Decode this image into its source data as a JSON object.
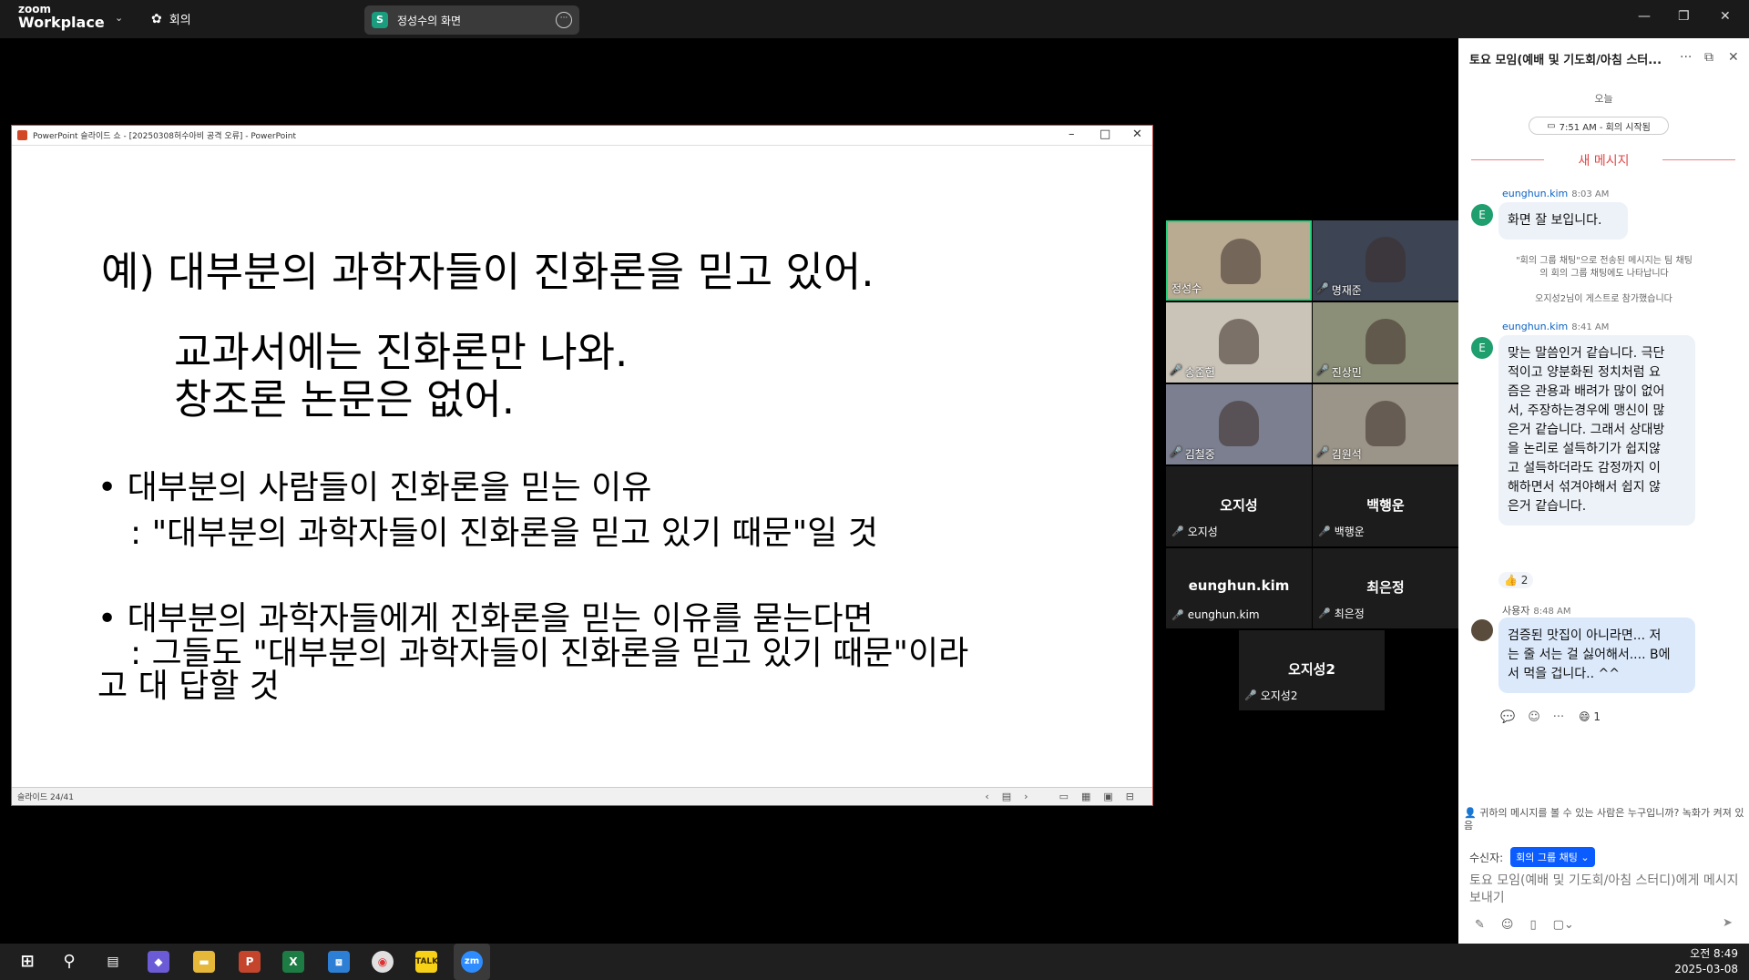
{
  "topbar": {
    "logo_line1": "zoom",
    "logo_line2": "Workplace",
    "meeting_label": "회의",
    "share_badge": "S",
    "share_name": "정성수의 화면"
  },
  "ppt": {
    "title": "PowerPoint 슬라이드 쇼 - [20250308허수아비 공격 오류] - PowerPoint",
    "status": "슬라이드 24/41",
    "slide": {
      "line1": "예) 대부분의 과학자들이 진화론을 믿고 있어.",
      "line2": "교과서에는 진화론만 나와.",
      "line3": "창조론 논문은 없어.",
      "bullet1": "• 대부분의 사람들이 진화론을 믿는 이유",
      "bullet1_sub": ": \"대부분의 과학자들이 진화론을 믿고 있기 때문\"일 것",
      "bullet2": "• 대부분의 과학자들에게 진화론을 믿는 이유를 묻는다면",
      "bullet2_sub": ": 그들도 \"대부분의 과학자들이 진화론을 믿고 있기 때문\"이라",
      "bullet2_sub2": "고 대 답할 것"
    }
  },
  "participants": {
    "video": [
      {
        "name": "정성수",
        "bg": "#b9aa92"
      },
      {
        "name": "명재준",
        "bg": "#3d4454"
      },
      {
        "name": "송준헌",
        "bg": "#c9c3b8"
      },
      {
        "name": "진상민",
        "bg": "#8c8f78"
      },
      {
        "name": "김철중",
        "bg": "#7b7f8f"
      },
      {
        "name": "김원석",
        "bg": "#9b9488"
      }
    ],
    "dark": [
      {
        "big": "오지성",
        "small": "오지성"
      },
      {
        "big": "백행운",
        "small": "백행운"
      },
      {
        "big": "eunghun.kim",
        "small": "eunghun.kim"
      },
      {
        "big": "최은정",
        "small": "최은정"
      },
      {
        "big": "오지성2",
        "small": "오지성2"
      }
    ]
  },
  "chat": {
    "title": "토요 모임(예배 및 기도회/아침 스터...",
    "day": "오늘",
    "meeting_start": "7:51 AM - 회의 시작됨",
    "new_messages": "새 메시지",
    "msg1": {
      "avatar": "E",
      "sender": "eunghun.kim",
      "time": "8:03 AM",
      "text": "화면 잘 보입니다."
    },
    "sys1_a": "\"회의 그룹 채팅\"으로 전송된 메시지는 팀 채팅",
    "sys1_b": "의 회의 그룹 채팅에도 나타납니다",
    "sys2": "오지성2님이 게스트로 참가했습니다",
    "msg2": {
      "avatar": "E",
      "sender": "eunghun.kim",
      "time": "8:41 AM",
      "lines": [
        "맞는 말씀인거 같습니다. 극단",
        "적이고 양분화된 정치처럼 요",
        "즘은 관용과 배려가 많이 없어",
        "서, 주장하는경우에 맹신이 많",
        "은거 같습니다. 그래서 상대방",
        "을 논리로 설득하기가 쉽지않",
        "고 설득하더라도 감정까지 이",
        "해하면서 섞겨야해서 쉽지 않",
        "은거 같습니다."
      ],
      "reaction": "👍 2"
    },
    "msg3": {
      "sender": "사용자",
      "time": "8:48 AM",
      "lines": [
        "검증된 맛집이 아니라면... 저",
        "는 줄 서는 걸 싫어해서.... B에",
        "서 먹을 겁니다.. ^^"
      ],
      "reaction": "😄 1"
    },
    "footer_note": "귀하의 메시지를 볼 수 있는 사람은 누구입니까? 녹화가 켜져 있음",
    "recipient_label": "수신자:",
    "recipient_value": "회의 그룹 채팅 ⌄",
    "compose_placeholder": "토요 모임(예배 및 기도회/아침 스터디)에게 메시지 보내기"
  },
  "taskbar": {
    "time": "오전 8:49",
    "date": "2025-03-08"
  }
}
